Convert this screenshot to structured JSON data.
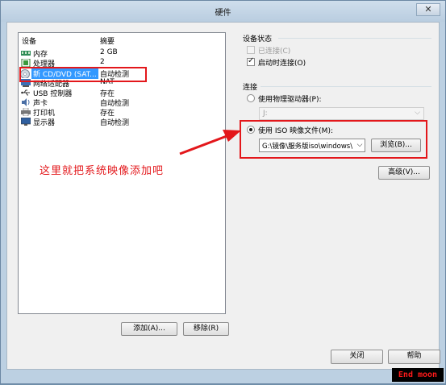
{
  "window": {
    "title": "硬件",
    "close_glyph": "✕"
  },
  "device_list": {
    "header": {
      "device": "设备",
      "summary": "摘要"
    },
    "rows": [
      {
        "name": "内存",
        "summary": "2 GB",
        "icon": "memory-icon"
      },
      {
        "name": "处理器",
        "summary": "2",
        "icon": "cpu-icon"
      },
      {
        "name": "新 CD/DVD (SAT...",
        "summary": "自动检测",
        "icon": "cd-dvd-icon",
        "selected": true
      },
      {
        "name": "网络适配器",
        "summary": "NAT",
        "icon": "network-adapter-icon"
      },
      {
        "name": "USB 控制器",
        "summary": "存在",
        "icon": "usb-icon"
      },
      {
        "name": "声卡",
        "summary": "自动检测",
        "icon": "sound-card-icon"
      },
      {
        "name": "打印机",
        "summary": "存在",
        "icon": "printer-icon"
      },
      {
        "name": "显示器",
        "summary": "自动检测",
        "icon": "display-icon"
      }
    ],
    "add_label": "添加(A)...",
    "remove_label": "移除(R)"
  },
  "device_status": {
    "title": "设备状态",
    "connected_label": "已连接(C)",
    "connected_checked": false,
    "connected_disabled": true,
    "connect_on_power_label": "启动时连接(O)",
    "connect_on_power_checked": true
  },
  "connection": {
    "title": "连接",
    "physical_drive_label": "使用物理驱动器(P):",
    "physical_drive_value": "J:",
    "iso_label": "使用 ISO 映像文件(M):",
    "iso_value": "G:\\镜像\\服务版iso\\windows\\",
    "browse_label": "浏览(B)...",
    "selected_option": "iso"
  },
  "advanced_label": "高级(V)...",
  "footer": {
    "close_label": "关闭",
    "help_label": "帮助"
  },
  "annotation_text": "这里就把系统映像添加吧",
  "watermark_text": "End moon",
  "colors": {
    "annotation": "#e3171b",
    "selection": "#3399ff"
  }
}
